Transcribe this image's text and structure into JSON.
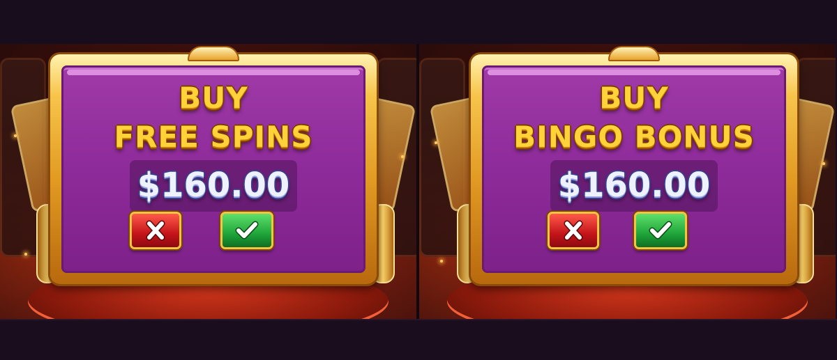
{
  "dialogs": [
    {
      "title_line1": "BUY",
      "title_line2": "FREE SPINS",
      "price": "$160.00",
      "cancel_icon": "close-icon",
      "confirm_icon": "checkmark-icon"
    },
    {
      "title_line1": "BUY",
      "title_line2": "BINGO BONUS",
      "price": "$160.00",
      "cancel_icon": "close-icon",
      "confirm_icon": "checkmark-icon"
    }
  ],
  "colors": {
    "background": "#170d1c",
    "frame_gold": "#f7c44a",
    "dialog_purple": "#8e2b9a",
    "title_yellow": "#ffd23a",
    "price_white": "#eef2ff",
    "cancel_red": "#c4141a",
    "confirm_green": "#1fa53a"
  }
}
